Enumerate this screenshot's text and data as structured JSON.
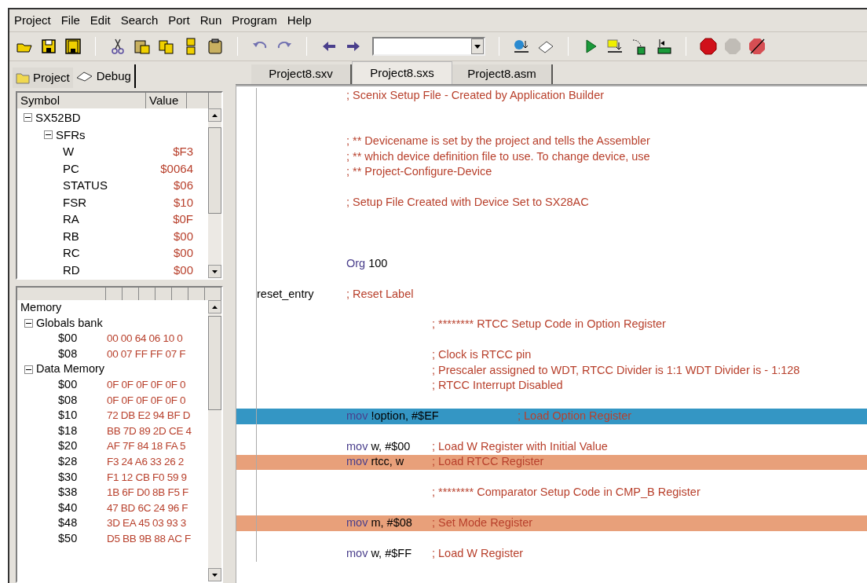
{
  "menu": [
    "Project",
    "File",
    "Edit",
    "Search",
    "Port",
    "Run",
    "Program",
    "Help"
  ],
  "left_tabs": [
    {
      "label": "Project",
      "selected": false
    },
    {
      "label": "Debug",
      "selected": true
    }
  ],
  "symbols": {
    "columns": [
      "Symbol",
      "Value"
    ],
    "tree": [
      {
        "label": "SX52BD",
        "expanded": true,
        "children": [
          {
            "label": "SFRs",
            "expanded": true,
            "children": [
              {
                "label": "W",
                "value": "$F3"
              },
              {
                "label": "PC",
                "value": "$0064"
              },
              {
                "label": "STATUS",
                "value": "$06"
              },
              {
                "label": "FSR",
                "value": "$10"
              },
              {
                "label": "RA",
                "value": "$0F"
              },
              {
                "label": "RB",
                "value": "$00"
              },
              {
                "label": "RC",
                "value": "$00"
              },
              {
                "label": "RD",
                "value": "$00"
              }
            ]
          }
        ]
      }
    ]
  },
  "memory": {
    "title": "Memory",
    "groups": [
      {
        "label": "Globals bank",
        "expanded": true,
        "rows": [
          {
            "address": "$00",
            "bytes": "00 00 64 06 10 0"
          },
          {
            "address": "$08",
            "bytes": "00 07 FF FF 07 F"
          }
        ]
      },
      {
        "label": "Data Memory",
        "expanded": true,
        "rows": [
          {
            "address": "$00",
            "bytes": "0F 0F 0F 0F 0F 0"
          },
          {
            "address": "$08",
            "bytes": "0F 0F 0F 0F 0F 0"
          },
          {
            "address": "$10",
            "bytes": "72 DB E2 94 BF D"
          },
          {
            "address": "$18",
            "bytes": "BB 7D 89 2D CE 4"
          },
          {
            "address": "$20",
            "bytes": "AF 7F 84 18 FA 5"
          },
          {
            "address": "$28",
            "bytes": "F3 24 A6 33 26 2"
          },
          {
            "address": "$30",
            "bytes": "F1 12 CB F0 59 9"
          },
          {
            "address": "$38",
            "bytes": "1B 6F D0 8B F5 F"
          },
          {
            "address": "$40",
            "bytes": "47 BD 6C 24 96 F"
          },
          {
            "address": "$48",
            "bytes": "3D EA 45 03 93 3"
          },
          {
            "address": "$50",
            "bytes": "D5 BB 9B 88 AC F"
          }
        ]
      }
    ]
  },
  "editor_tabs": [
    {
      "label": "Project8.sxv",
      "selected": false
    },
    {
      "label": "Project8.sxs",
      "selected": true
    },
    {
      "label": "Project8.asm",
      "selected": false
    }
  ],
  "code": [
    {
      "kind": "comment",
      "comment": "; Scenix Setup File - Created by Application Builder"
    },
    {
      "kind": "blank"
    },
    {
      "kind": "blank"
    },
    {
      "kind": "comment",
      "comment": "; ** Devicename is set by the project and tells the Assembler"
    },
    {
      "kind": "comment",
      "comment": "; ** which device definition file to use.  To change device, use"
    },
    {
      "kind": "comment",
      "comment": "; ** Project-Configure-Device"
    },
    {
      "kind": "blank"
    },
    {
      "kind": "comment",
      "comment": "; Setup File Created with Device Set to SX28AC"
    },
    {
      "kind": "blank"
    },
    {
      "kind": "blank"
    },
    {
      "kind": "blank"
    },
    {
      "kind": "instruction",
      "keyword": "Org",
      "operand": "100",
      "current": false,
      "breakpoint": false
    },
    {
      "kind": "blank"
    },
    {
      "kind": "label",
      "label": "reset_entry",
      "comment": "; Reset Label"
    },
    {
      "kind": "blank"
    },
    {
      "kind": "block_comment",
      "comment": "; ******** RTCC Setup Code in Option Register"
    },
    {
      "kind": "blank"
    },
    {
      "kind": "block_comment",
      "comment": "; Clock is  RTCC pin"
    },
    {
      "kind": "block_comment",
      "comment": "; Prescaler assigned to WDT, RTCC Divider is 1:1 WDT Divider is - 1:128"
    },
    {
      "kind": "block_comment",
      "comment": "; RTCC Interrupt Disabled"
    },
    {
      "kind": "blank"
    },
    {
      "kind": "instruction",
      "keyword": "mov",
      "operand": "!option, #$EF",
      "comment": "; Load Option Register",
      "current": true
    },
    {
      "kind": "blank"
    },
    {
      "kind": "instruction",
      "keyword": "mov",
      "operand": "w, #$00",
      "comment": "; Load W Register with Initial Value",
      "current": false,
      "breakpoint": false
    },
    {
      "kind": "instruction",
      "keyword": "mov",
      "operand": "rtcc, w",
      "comment": "; Load RTCC Register",
      "current": false,
      "breakpoint": true
    },
    {
      "kind": "blank"
    },
    {
      "kind": "block_comment",
      "comment": "; ******** Comparator Setup Code in CMP_B Register"
    },
    {
      "kind": "blank"
    },
    {
      "kind": "instruction",
      "keyword": "mov",
      "operand": "m, #$08",
      "comment": "; Set Mode Register",
      "current": false,
      "breakpoint": true
    },
    {
      "kind": "blank"
    },
    {
      "kind": "instruction",
      "keyword": "mov",
      "operand": "w, #$FF",
      "comment": "; Load W Register",
      "current": false,
      "breakpoint": false
    }
  ]
}
